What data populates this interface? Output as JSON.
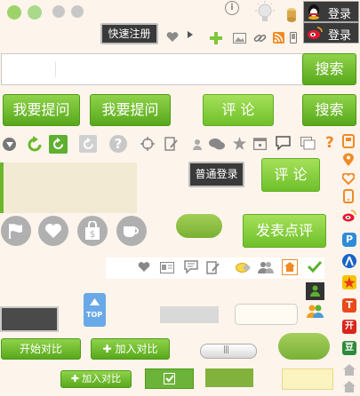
{
  "top": {
    "login_label": "登录",
    "quick_register": "快速注册"
  },
  "search": {
    "placeholder": "",
    "button": "搜索",
    "side_button": "搜索"
  },
  "buttons": {
    "ask1": "我要提问",
    "ask2": "我要提问",
    "comment1": "评 论",
    "comment2": "评 论",
    "normal_login": "普通登录",
    "post_review": "发表点评",
    "top": "TOP",
    "start_compare": "开始对比",
    "add_compare": "加入对比",
    "add_compare_small": "加入对比"
  },
  "icons": {
    "help_question": "?",
    "orange_question": "?"
  },
  "colors": {
    "green_dark": "#58a81c",
    "green_light": "#8fd34a",
    "dark_button": "#3a3a3a",
    "page_bg": "#fdf4ec",
    "beige_box": "#f3ead4",
    "blue_top": "#6aa9e8"
  }
}
